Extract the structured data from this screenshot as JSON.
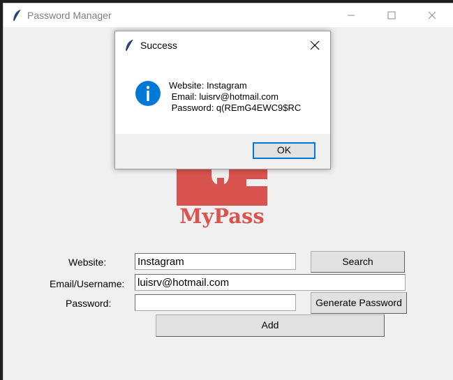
{
  "window": {
    "title": "Password Manager",
    "controls": {
      "minimize": "minimize-icon",
      "maximize": "maximize-icon",
      "close": "close-icon"
    }
  },
  "logo": {
    "text": "MyPass",
    "color": "#d9534f"
  },
  "form": {
    "website_label": "Website:",
    "website_value": "Instagram",
    "email_label": "Email/Username:",
    "email_value": "luisrv@hotmail.com",
    "password_label": "Password:",
    "password_value": "",
    "search_button": "Search",
    "generate_button": "Generate Password",
    "add_button": "Add"
  },
  "dialog": {
    "title": "Success",
    "icon": "info-icon",
    "message_lines": [
      "Website: Instagram",
      " Email: luisrv@hotmail.com",
      " Password: q(REmG4EWC9$RC"
    ],
    "ok_button": "OK",
    "accent": "#0078d7"
  }
}
